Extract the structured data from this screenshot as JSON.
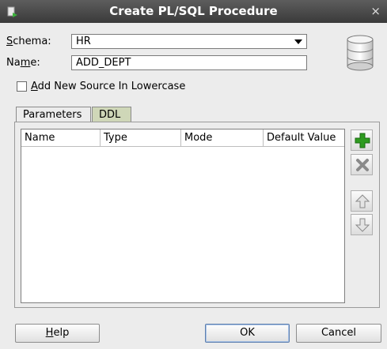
{
  "window": {
    "title": "Create PL/SQL Procedure",
    "close_glyph": "×"
  },
  "form": {
    "schema_label_prefix": "",
    "schema_label_mnemonic": "S",
    "schema_label_rest": "chema:",
    "schema_value": "HR",
    "name_label_prefix": "Na",
    "name_label_mnemonic": "m",
    "name_label_rest": "e:",
    "name_value": "ADD_DEPT",
    "checkbox_mnemonic": "A",
    "checkbox_rest": "dd New Source In Lowercase",
    "checkbox_checked": false
  },
  "tabs": [
    {
      "label": "Parameters",
      "active": true
    },
    {
      "label": "DDL",
      "active": false
    }
  ],
  "table": {
    "columns": [
      "Name",
      "Type",
      "Mode",
      "Default Value"
    ],
    "rows": []
  },
  "side_buttons": [
    "add-icon",
    "remove-icon",
    "move-up-icon",
    "move-down-icon"
  ],
  "buttons": {
    "help_mnemonic": "H",
    "help_rest": "elp",
    "ok": "OK",
    "cancel": "Cancel"
  },
  "colors": {
    "titlebar": "#3a3a3a",
    "ddl_tab": "#cfd7b8",
    "add_green": "#2e9b1f"
  }
}
